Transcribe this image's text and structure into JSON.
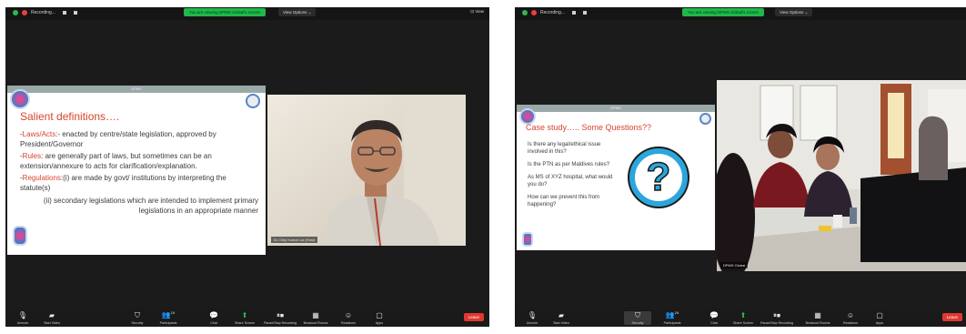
{
  "colors": {
    "zoom_bg": "#1b1b1b",
    "share_green": "#1fb84a",
    "end_red": "#e0382f",
    "slide_title_red": "#d8442e"
  },
  "left": {
    "recording_label": "Recording...",
    "share_banner": "You are viewing DPMS Global's screen",
    "view_options": "View Options ⌄",
    "view_right": "⊡ View",
    "slide": {
      "header": "DPMS",
      "title": "Salient definitions….",
      "p1_red": "Laws/Acts",
      "p1_rest": ":- enacted by centre/state legislation, approved by President/Governor",
      "p2_red": "Rules",
      "p2_rest": ": are generally part of laws, but sometimes can be an extension/annexure to acts for clarification/explanation.",
      "p3_red": "Regulations",
      "p3_rest": ":(i) are made by govt/ institutions by interpreting the statute(s)",
      "p4": "(ii) secondary legislations which are intended to implement primary legislations in an appropriate manner"
    },
    "video_name": "Dr. Dilip Kumar Lal (Host)",
    "toolbar": {
      "unmute": "Unmute",
      "start_video": "Start Video",
      "security": "Security",
      "participants": "Participants",
      "participants_count": "10",
      "chat": "Chat",
      "share_screen": "Share Screen",
      "record": "Pause/Stop Recording",
      "breakout": "Breakout Rooms",
      "reactions": "Reactions",
      "apps": "Apps",
      "end": "Leave"
    }
  },
  "right": {
    "recording_label": "Recording...",
    "share_banner": "You are viewing DPMS Global's screen",
    "view_options": "View Options ⌄",
    "slide": {
      "header": "DPMS",
      "title": "Case study….. Some Questions??",
      "q1": "Is there any legal/ethical issue involved in this?",
      "q2": "Is the PTN as per Maldives rules?",
      "q3": "As MS of XYZ hospital, what would you do?",
      "q4": "How can we prevent this from happening?",
      "q_mark": "?"
    },
    "video_name": "DPMS Global",
    "toolbar": {
      "unmute": "Unmute",
      "start_video": "Start Video",
      "security": "Security",
      "participants": "Participants",
      "participants_count": "24",
      "chat": "Chat",
      "share_screen": "Share Screen",
      "record": "Pause/Stop Recording",
      "breakout": "Breakout Rooms",
      "reactions": "Reactions",
      "apps": "Apps",
      "end": "Leave"
    }
  }
}
